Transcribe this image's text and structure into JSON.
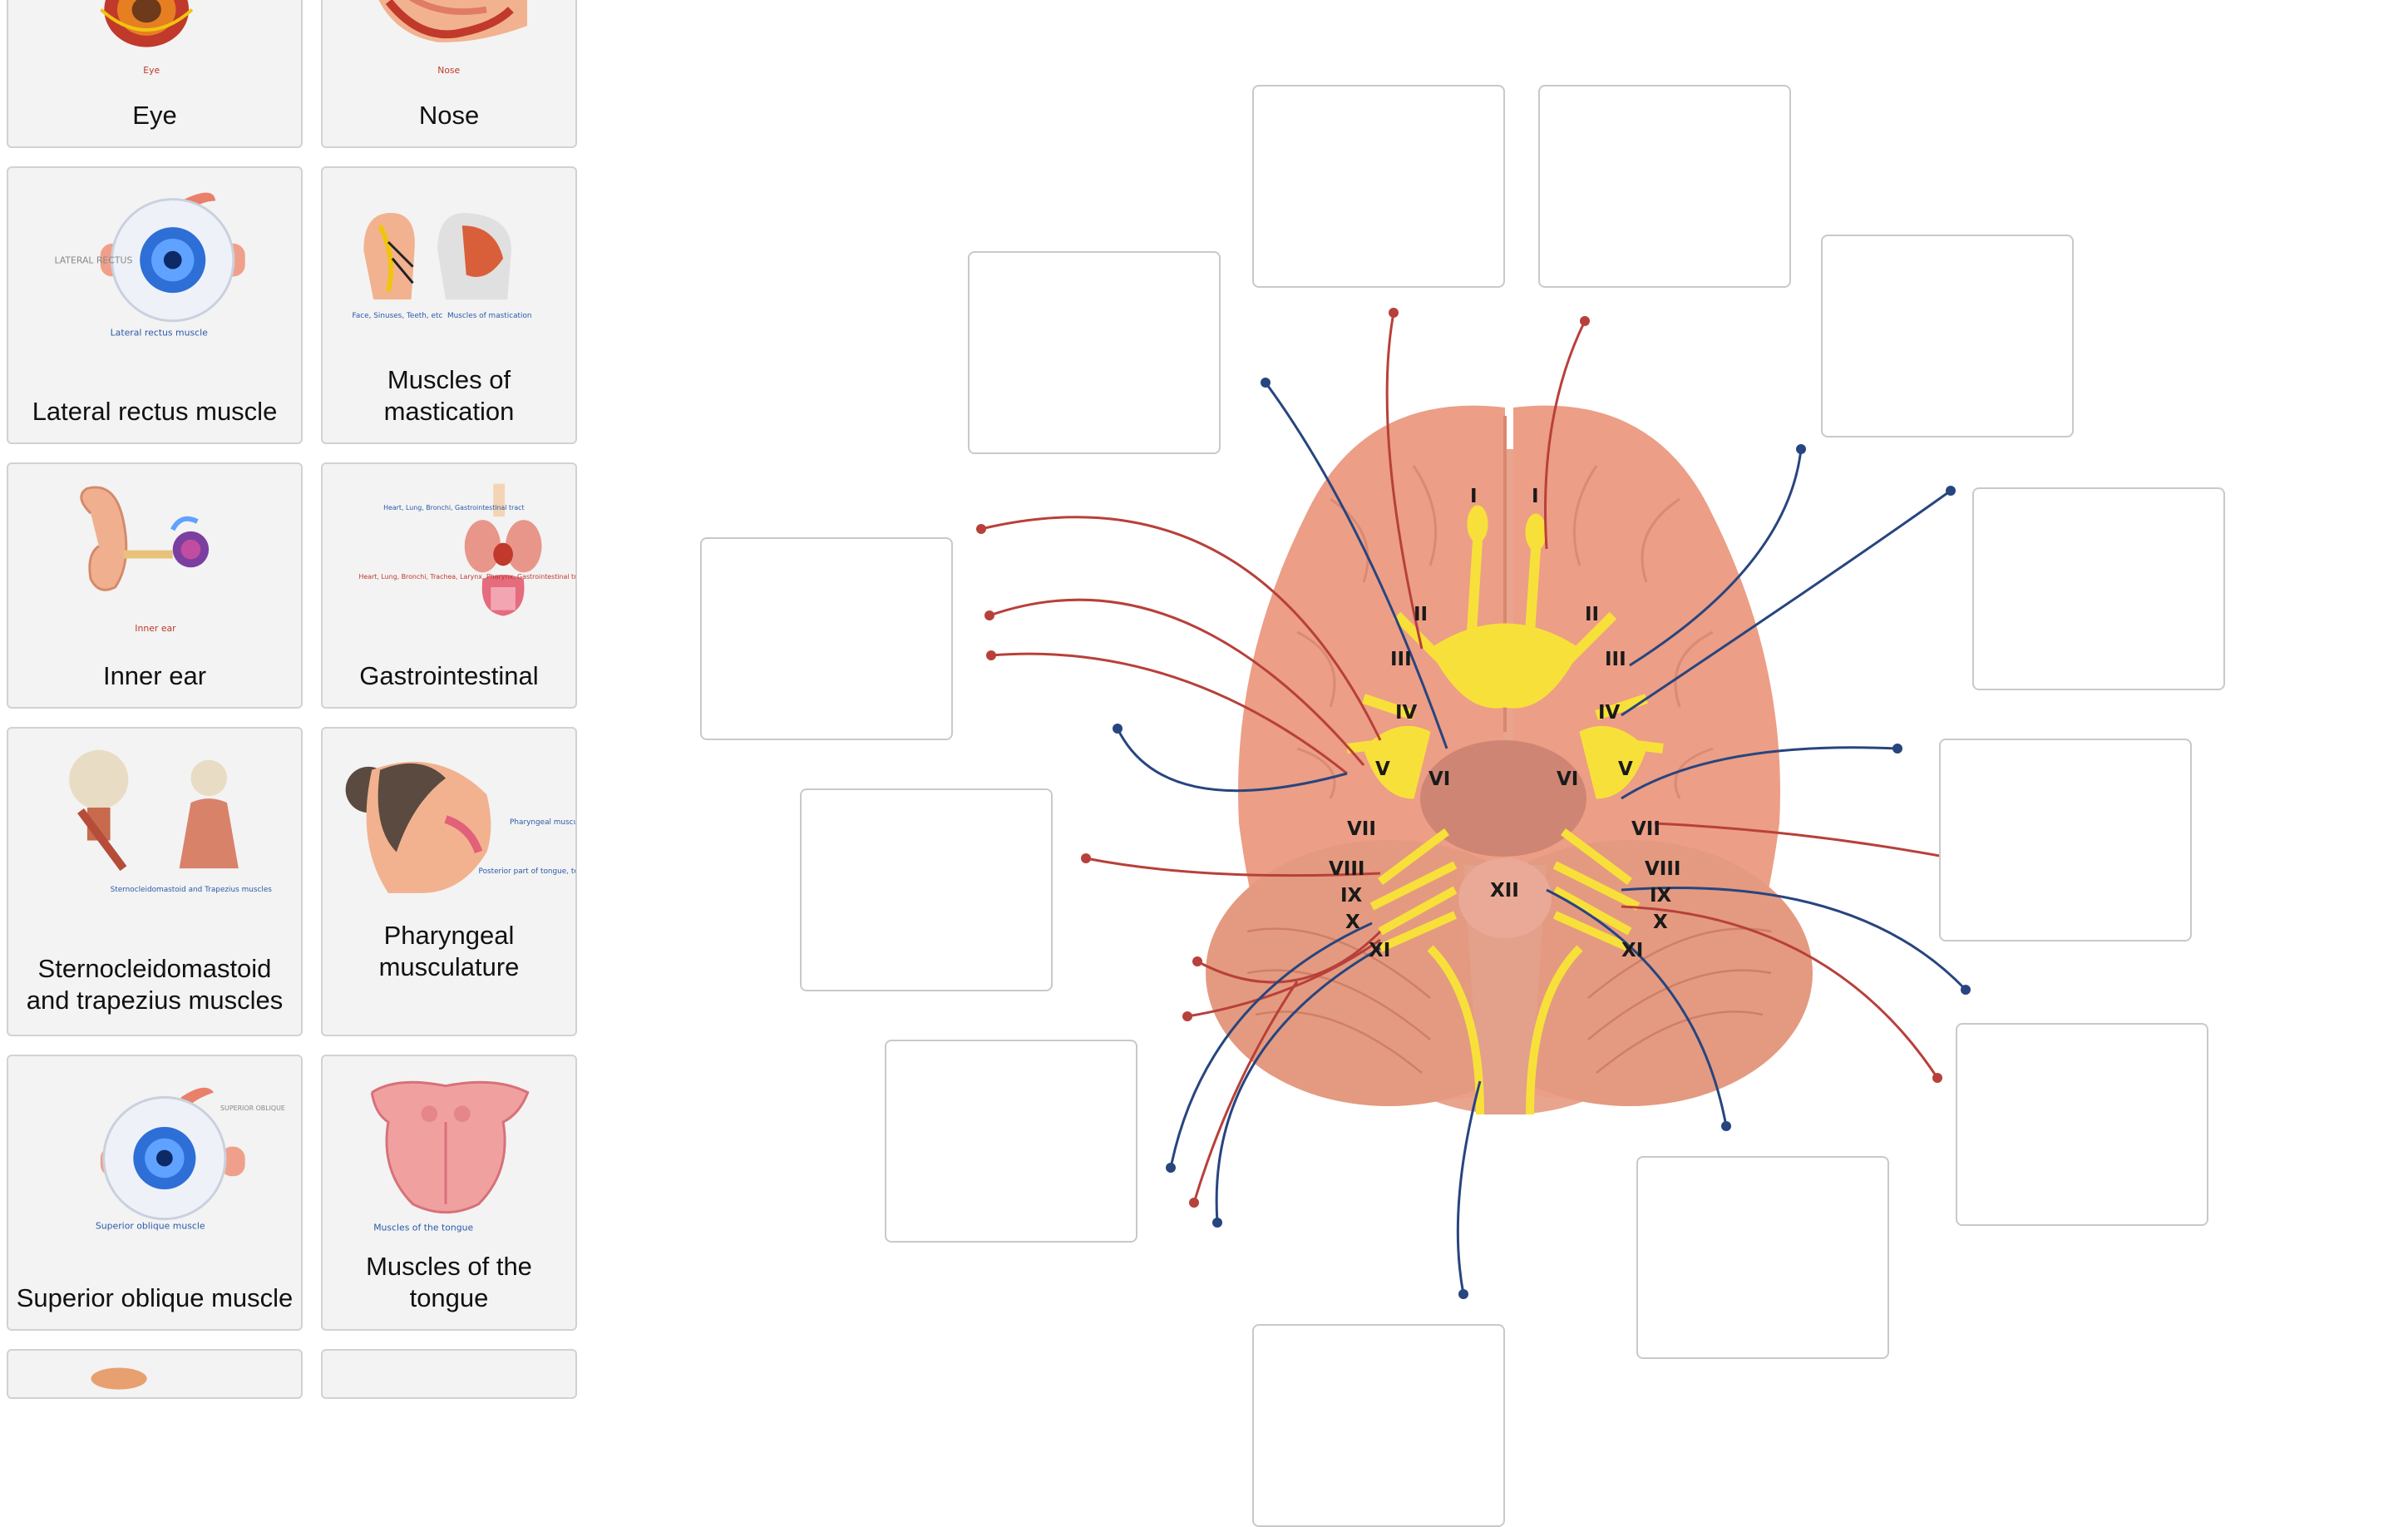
{
  "cards": [
    {
      "label": "Eye",
      "caption": "Eye"
    },
    {
      "label": "Nose",
      "caption": "Nose"
    },
    {
      "label": "Lateral rectus muscle",
      "caption": "Lateral rectus muscle",
      "side_caption": "LATERAL RECTUS"
    },
    {
      "label": "Muscles of mastication",
      "caption_left": "Face, Sinuses, Teeth, etc",
      "caption_right": "Muscles of mastication"
    },
    {
      "label": "Inner ear",
      "caption": "Inner ear"
    },
    {
      "label": "Gastrointestinal",
      "caption_top": "Heart, Lung, Bronchi, Gastrointestinal tract",
      "caption_left": "Heart, Lung, Bronchi, Trachea, Larynx, Pharynx, Gastrointestinal tract, External ear"
    },
    {
      "label": "Sternocleidomastoid and trapezius muscles",
      "caption": "Sternocleidomastoid and Trapezius muscles"
    },
    {
      "label": "Pharyngeal musculature",
      "caption_top": "Pharyngeal musculature",
      "caption_bottom": "Posterior part of tongue, tonsil, pharynx"
    },
    {
      "label": "Superior oblique muscle",
      "caption": "Superior oblique muscle",
      "side_caption": "SUPERIOR OBLIQUE"
    },
    {
      "label": "Muscles of the tongue",
      "caption": "Muscles of the tongue"
    }
  ],
  "nerve_labels": {
    "I": "I",
    "II": "II",
    "III": "III",
    "IV": "IV",
    "V": "V",
    "VI": "VI",
    "VII": "VII",
    "VIII": "VIII",
    "IX": "IX",
    "X": "X",
    "XI": "XI",
    "XII": "XII"
  },
  "colors": {
    "brain": "#e8a48c",
    "nerve": "#f8e03a",
    "sensory_line": "#b8403a",
    "motor_line": "#27457f",
    "card_bg": "#f3f3f3",
    "card_border": "#d2d2d2"
  }
}
